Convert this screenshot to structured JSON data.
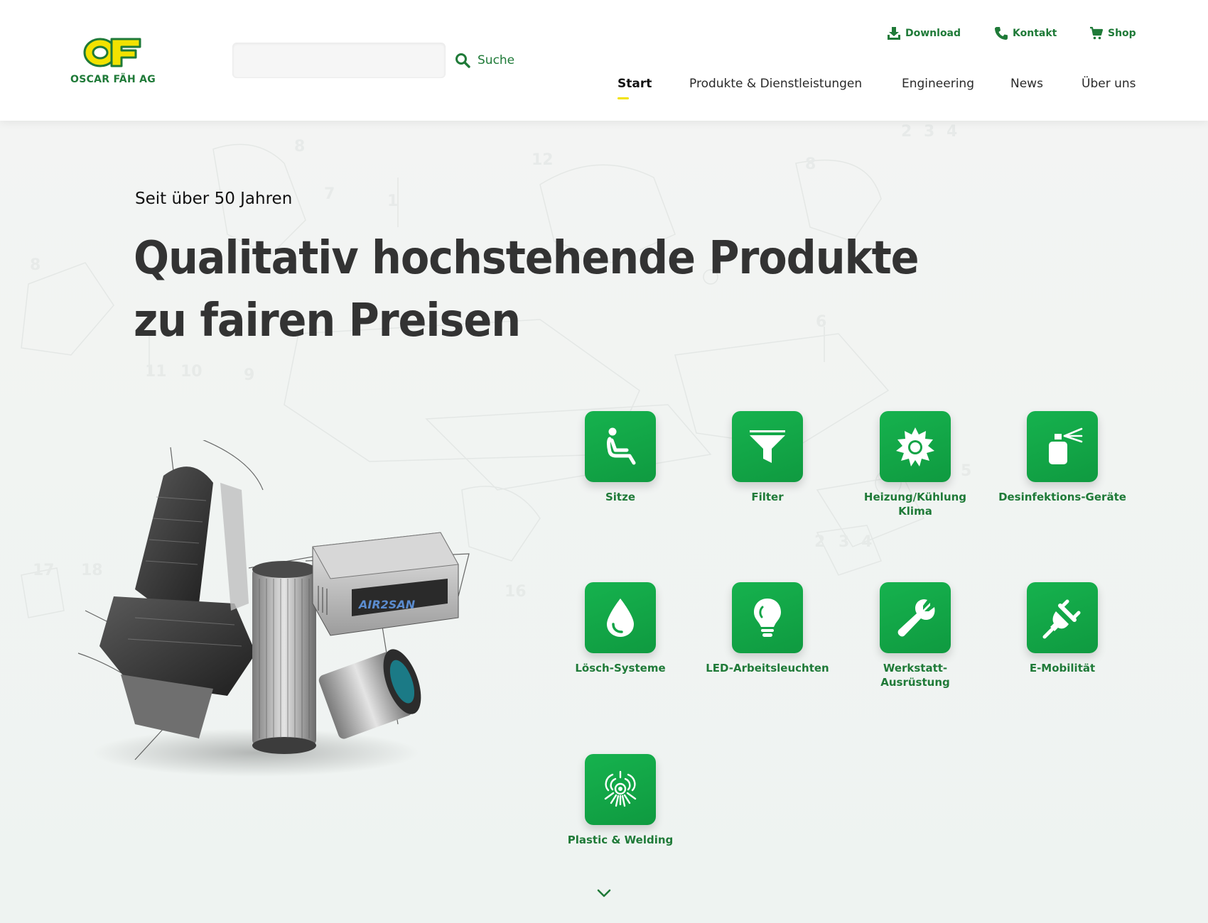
{
  "brand": {
    "logo_letters": "OF",
    "name": "OSCAR FÄH AG",
    "colors": {
      "green": "#1f7a38",
      "yellow": "#f2e200",
      "tile_green": "#13a847"
    }
  },
  "search": {
    "value": "",
    "placeholder": "",
    "button_label": "Suche",
    "icon": "search-icon"
  },
  "utility_nav": [
    {
      "label": "Download",
      "icon": "download-icon"
    },
    {
      "label": "Kontakt",
      "icon": "phone-icon"
    },
    {
      "label": "Shop",
      "icon": "cart-icon"
    }
  ],
  "main_nav": [
    {
      "label": "Start",
      "active": true
    },
    {
      "label": "Produkte & Dienstleistungen",
      "active": false
    },
    {
      "label": "Engineering",
      "active": false
    },
    {
      "label": "News",
      "active": false
    },
    {
      "label": "Über uns",
      "active": false
    }
  ],
  "hero": {
    "eyebrow": "Seit über 50 Jahren",
    "headline_line1": "Qualitativ hochstehende Produkte",
    "headline_line2": "zu fairen Preisen",
    "product_brand_text": "AIR2SAN"
  },
  "categories": [
    {
      "label": "Sitze",
      "icon": "seat-icon"
    },
    {
      "label": "Filter",
      "icon": "filter-icon"
    },
    {
      "label": "Heizung/Kühlung Klima",
      "icon": "sun-icon"
    },
    {
      "label": "Desinfektions-Geräte",
      "icon": "spray-icon"
    },
    {
      "label": "Lösch-Systeme",
      "icon": "drop-icon"
    },
    {
      "label": "LED-Arbeitsleuchten",
      "icon": "bulb-icon"
    },
    {
      "label": "Werkstatt-Ausrüstung",
      "icon": "wrench-icon"
    },
    {
      "label": "E-Mobilität",
      "icon": "plug-icon"
    },
    {
      "label": "Plastic & Welding",
      "icon": "welding-icon"
    }
  ],
  "scroll_icon": "chevron-down-icon"
}
